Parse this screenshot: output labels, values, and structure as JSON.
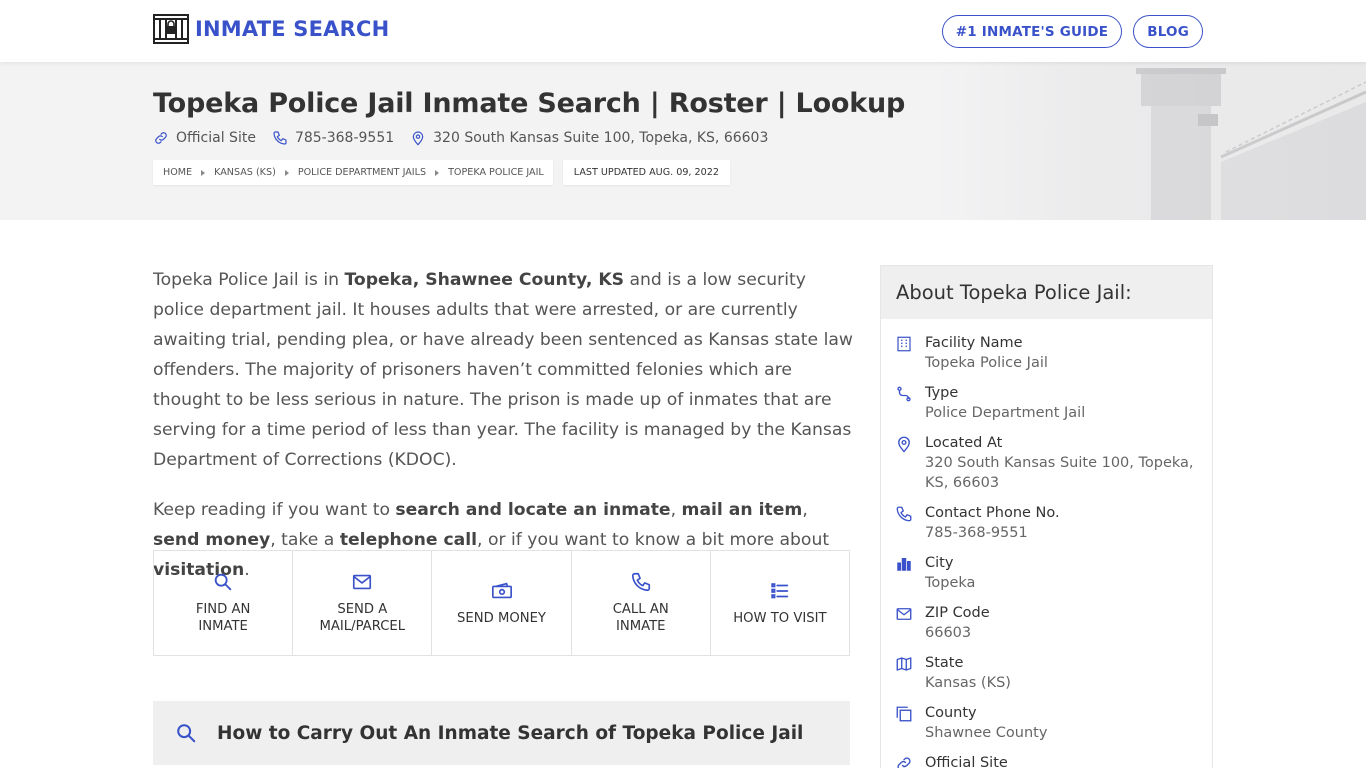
{
  "header": {
    "logo_text": "INMATE SEARCH",
    "nav": [
      "#1 INMATE'S GUIDE",
      "BLOG"
    ]
  },
  "hero": {
    "title": "Topeka Police Jail Inmate Search | Roster | Lookup",
    "official_site": "Official Site",
    "phone": "785-368-9551",
    "address": "320 South Kansas Suite 100, Topeka, KS, 66603",
    "breadcrumbs": [
      "HOME",
      "KANSAS (KS)",
      "POLICE DEPARTMENT JAILS",
      "TOPEKA POLICE JAIL"
    ],
    "last_updated": "LAST UPDATED AUG. 09, 2022"
  },
  "intro": {
    "p1_a": "Topeka Police Jail is in ",
    "p1_b": "Topeka, Shawnee County, KS",
    "p1_c": " and is a low security police department jail. It houses adults that were arrested, or are currently awaiting trial, pending plea, or have already been sentenced as Kansas state law offenders. The majority of prisoners haven’t committed felonies which are thought to be less serious in nature. The prison is made up of inmates that are serving for a time period of less than year. The facility is managed by the Kansas Department of Corrections (KDOC).",
    "p2_a": "Keep reading if you want to ",
    "p2_b": "search and locate an inmate",
    "p2_c": ", ",
    "p2_d": "mail an item",
    "p2_e": ", ",
    "p2_f": "send money",
    "p2_g": ", take a ",
    "p2_h": "telephone call",
    "p2_i": ", or if you want to know a bit more about ",
    "p2_j": "visitation",
    "p2_k": "."
  },
  "actions": [
    {
      "line1": "FIND AN",
      "line2": "INMATE",
      "icon": "search-icon"
    },
    {
      "line1": "SEND A",
      "line2": "MAIL/PARCEL",
      "icon": "mail-icon"
    },
    {
      "line1": "SEND MONEY",
      "line2": "",
      "icon": "money-icon"
    },
    {
      "line1": "CALL AN",
      "line2": "INMATE",
      "icon": "phone-icon"
    },
    {
      "line1": "HOW TO VISIT",
      "line2": "",
      "icon": "list-icon"
    }
  ],
  "howto": {
    "heading": "How to Carry Out An Inmate Search of Topeka Police Jail"
  },
  "sidebar": {
    "title": "About Topeka Police Jail:",
    "facts": [
      {
        "label": "Facility Name",
        "value": "Topeka Police Jail",
        "icon": "building-icon"
      },
      {
        "label": "Type",
        "value": "Police Department Jail",
        "icon": "route-icon"
      },
      {
        "label": "Located At",
        "value": "320 South Kansas Suite 100, Topeka, KS, 66603",
        "icon": "map-pin-icon"
      },
      {
        "label": "Contact Phone No.",
        "value": "785-368-9551",
        "icon": "phone-icon"
      },
      {
        "label": "City",
        "value": "Topeka",
        "icon": "city-icon"
      },
      {
        "label": "ZIP Code",
        "value": "66603",
        "icon": "mail-icon"
      },
      {
        "label": "State",
        "value": "Kansas (KS)",
        "icon": "map-icon"
      },
      {
        "label": "County",
        "value": "Shawnee County",
        "icon": "copy-icon"
      },
      {
        "label": "Official Site",
        "value": "",
        "icon": "link-icon"
      }
    ]
  },
  "colors": {
    "accent": "#3a52c9",
    "hero_bg": "#f3f3f4",
    "panel_bg": "#efefef"
  }
}
